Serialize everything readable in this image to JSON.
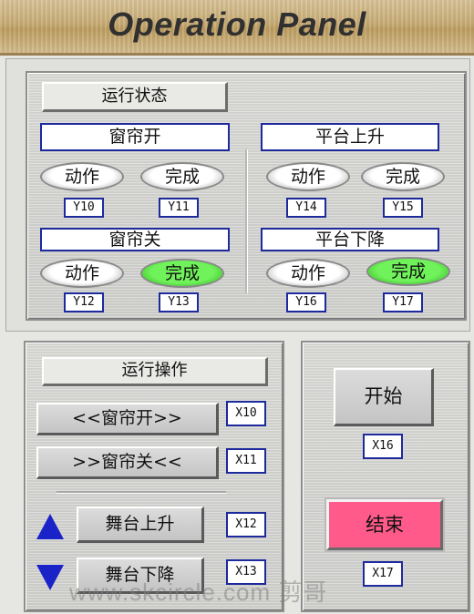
{
  "header": {
    "title": "Operation Panel"
  },
  "status": {
    "title": "运行状态",
    "groups": [
      {
        "label": "窗帘开",
        "action": {
          "text": "动作",
          "addr": "Y10",
          "on": false
        },
        "done": {
          "text": "完成",
          "addr": "Y11",
          "on": false
        }
      },
      {
        "label": "平台上升",
        "action": {
          "text": "动作",
          "addr": "Y14",
          "on": false
        },
        "done": {
          "text": "完成",
          "addr": "Y15",
          "on": false
        }
      },
      {
        "label": "窗帘关",
        "action": {
          "text": "动作",
          "addr": "Y12",
          "on": false
        },
        "done": {
          "text": "完成",
          "addr": "Y13",
          "on": true
        }
      },
      {
        "label": "平台下降",
        "action": {
          "text": "动作",
          "addr": "Y16",
          "on": false
        },
        "done": {
          "text": "完成",
          "addr": "Y17",
          "on": true
        }
      }
    ]
  },
  "operation": {
    "title": "运行操作",
    "buttons": [
      {
        "label": "<<窗帘开>>",
        "addr": "X10"
      },
      {
        "label": ">>窗帘关<<",
        "addr": "X11"
      },
      {
        "label": "舞台上升",
        "addr": "X12"
      },
      {
        "label": "舞台下降",
        "addr": "X13"
      }
    ]
  },
  "control": {
    "start": {
      "label": "开始",
      "addr": "X16"
    },
    "stop": {
      "label": "结束",
      "addr": "X17"
    }
  },
  "watermark": "www.skcircle.com 剪哥",
  "colors": {
    "lamp_on": "#58e046",
    "stop_button": "#ff5a8a",
    "address_border": "#1d2a9c",
    "arrow": "#1a23c8"
  },
  "icons": {
    "up": "triangle-up",
    "down": "triangle-down"
  }
}
